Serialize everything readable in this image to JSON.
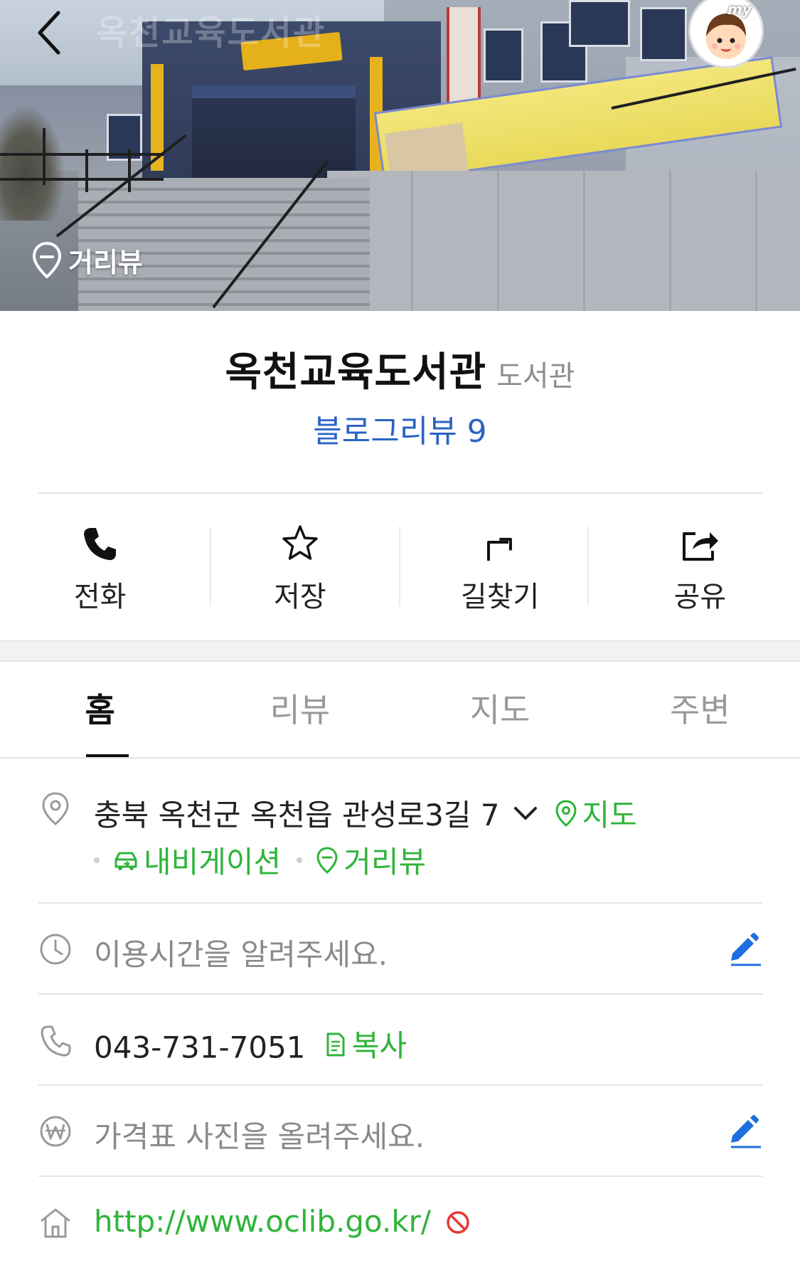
{
  "hero": {
    "ghost_title": "옥천교육도서관",
    "street_view_label": "거리뷰",
    "avatar_badge": "my"
  },
  "place": {
    "name": "옥천교육도서관",
    "category": "도서관",
    "blog_review": "블로그리뷰 9"
  },
  "actions": [
    {
      "label": "전화",
      "icon": "phone-icon"
    },
    {
      "label": "저장",
      "icon": "star-icon"
    },
    {
      "label": "길찾기",
      "icon": "directions-icon"
    },
    {
      "label": "공유",
      "icon": "share-icon"
    }
  ],
  "tabs": [
    {
      "label": "홈",
      "active": true
    },
    {
      "label": "리뷰",
      "active": false
    },
    {
      "label": "지도",
      "active": false
    },
    {
      "label": "주변",
      "active": false
    }
  ],
  "info": {
    "address": "충북 옥천군 옥천읍 관성로3길 7",
    "map_link": "지도",
    "navigation_link": "내비게이션",
    "street_view_link": "거리뷰",
    "hours_placeholder": "이용시간을 알려주세요.",
    "phone": "043-731-7051",
    "copy_label": "복사",
    "price_placeholder": "가격표 사진을 올려주세요.",
    "website": "http://www.oclib.go.kr/"
  },
  "colors": {
    "link_blue": "#2a64c4",
    "green": "#2fb43a",
    "edit_blue": "#1f6fe0",
    "blocked_red": "#e53935"
  }
}
